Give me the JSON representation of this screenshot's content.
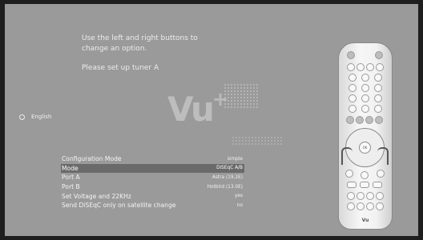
{
  "help": {
    "line1": "Use the left and right buttons to",
    "line2": "change an option.",
    "tuner": "Please set up tuner A"
  },
  "language": {
    "label": "English"
  },
  "logo": {
    "text": "Vu",
    "plus": "+"
  },
  "config": {
    "rows": [
      {
        "label": "Configuration Mode",
        "value": "simple",
        "selected": false
      },
      {
        "label": "Mode",
        "value": "DiSEqC A/B",
        "selected": true
      },
      {
        "label": "Port A",
        "value": "Astra (19.2E)",
        "selected": false
      },
      {
        "label": "Port B",
        "value": "Hotbird (13.0E)",
        "selected": false
      },
      {
        "label": "Set Voltage and 22KHz",
        "value": "yes",
        "selected": false
      },
      {
        "label": "Send DiSEqC only on satellite change",
        "value": "no",
        "selected": false
      }
    ]
  },
  "remote": {
    "ok_label": "OK",
    "brand": "Vu"
  }
}
